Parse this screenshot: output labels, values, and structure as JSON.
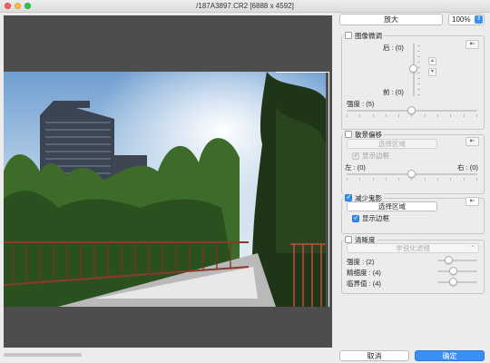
{
  "window": {
    "title": "/187A3897.CR2 [6888 x 4592]"
  },
  "zoom": {
    "button_label": "放大",
    "level": "100%"
  },
  "image_tilt": {
    "label": "图像微调",
    "checked": false,
    "back_label": "后 : (0)",
    "front_label": "前 : (0)",
    "strength_label": "强度 : (5)"
  },
  "shift": {
    "label": "散景偏移",
    "checked": false,
    "select_area": "选择区域",
    "show_border": "显示边框",
    "left_label": "左 : (0)",
    "right_label": "右 : (0)"
  },
  "ghost": {
    "label": "减少鬼影",
    "checked": true,
    "select_area": "选择区域",
    "show_border": "显示边框",
    "show_border_checked": true
  },
  "sharpness": {
    "label": "清晰度",
    "checked": false,
    "filter": "非锐化滤镜",
    "strength_label": "强度 : (2)",
    "fineness_label": "精细度 : (4)",
    "threshold_label": "临界值 : (4)"
  },
  "footer": {
    "cancel": "取消",
    "ok": "确定"
  },
  "colors": {
    "accent": "#3a8ff5",
    "preview_bg": "#4d4d4d"
  }
}
